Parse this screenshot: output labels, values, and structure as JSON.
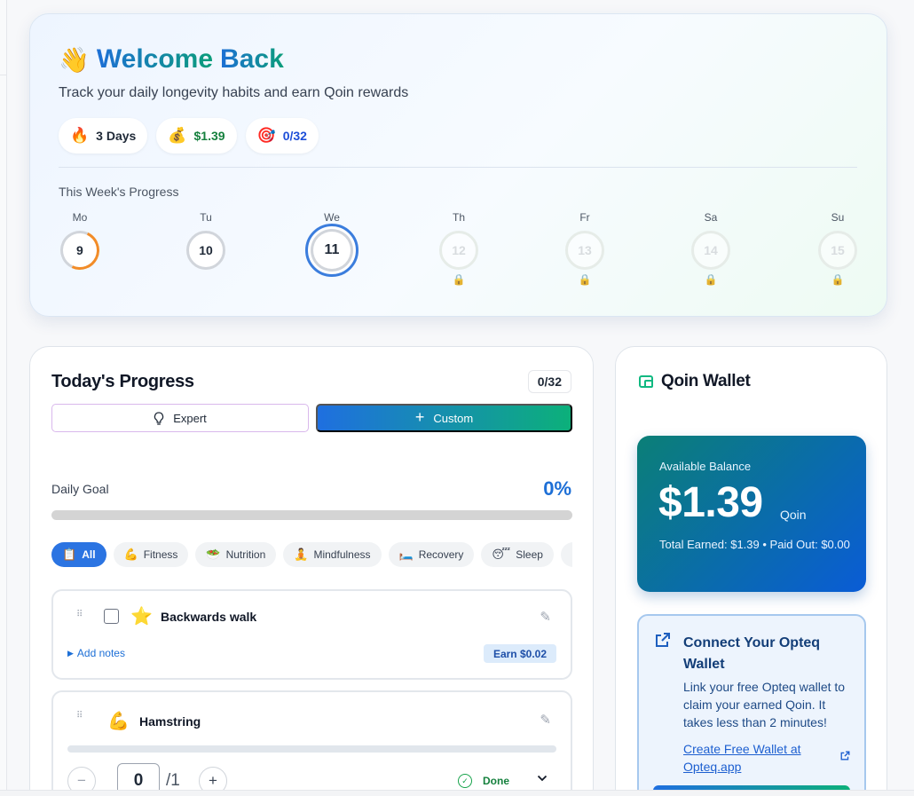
{
  "welcome": {
    "wave_emoji": "👋",
    "title_part1": "Welcome",
    "title_part2": "Back",
    "subtitle": "Track your daily longevity habits and earn Qoin rewards",
    "chips": {
      "streak": {
        "emoji": "🔥",
        "text": "3 Days"
      },
      "money": {
        "emoji": "💰",
        "text": "$1.39"
      },
      "target": {
        "emoji": "🎯",
        "text": "0/32"
      }
    },
    "week_label": "This Week's Progress",
    "days": [
      {
        "name": "Mo",
        "num": "9",
        "state": "partial"
      },
      {
        "name": "Tu",
        "num": "10",
        "state": "empty"
      },
      {
        "name": "We",
        "num": "11",
        "state": "today"
      },
      {
        "name": "Th",
        "num": "12",
        "state": "locked"
      },
      {
        "name": "Fr",
        "num": "13",
        "state": "locked"
      },
      {
        "name": "Sa",
        "num": "14",
        "state": "locked"
      },
      {
        "name": "Su",
        "num": "15",
        "state": "locked"
      }
    ],
    "lock_emoji": "🔒"
  },
  "progress": {
    "title": "Today's Progress",
    "count": "0/32",
    "expert_label": "Expert",
    "custom_label": "Custom",
    "goal_label": "Daily Goal",
    "goal_pct": "0%",
    "goal_fraction": 0,
    "categories": [
      {
        "emoji": "📋",
        "label": "All",
        "active": true
      },
      {
        "emoji": "💪",
        "label": "Fitness"
      },
      {
        "emoji": "🥗",
        "label": "Nutrition"
      },
      {
        "emoji": "🧘",
        "label": "Mindfulness"
      },
      {
        "emoji": "🛏️",
        "label": "Recovery"
      },
      {
        "emoji": "😴",
        "label": "Sleep"
      },
      {
        "emoji": "🧠",
        "label": ""
      }
    ],
    "habits": {
      "h1": {
        "emoji": "⭐",
        "name": "Backwards walk",
        "notes": "Add notes",
        "earn": "Earn $0.02"
      },
      "h2": {
        "emoji": "💪",
        "name": "Hamstring",
        "value": "0",
        "max": "/1",
        "done": "Done"
      }
    }
  },
  "wallet": {
    "title": "Qoin Wallet",
    "balance_label": "Available Balance",
    "balance_amount": "$1.39",
    "balance_unit": "Qoin",
    "totals": "Total Earned: $1.39 • Paid Out: $0.00",
    "connect_title": "Connect Your Opteq Wallet",
    "connect_text": "Link your free Opteq wallet to claim your earned Qoin. It takes less than 2 minutes!",
    "connect_link": "Create Free Wallet at Opteq.app"
  },
  "colors": {
    "accent_blue": "#1d6fd6",
    "accent_green": "#0cb07a",
    "streak_orange": "#f28c28"
  }
}
